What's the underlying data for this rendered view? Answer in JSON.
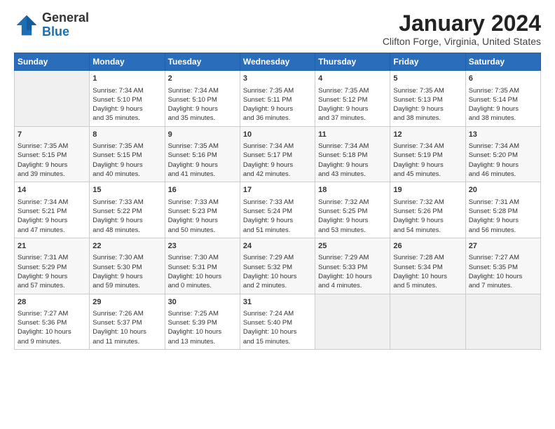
{
  "header": {
    "logo_general": "General",
    "logo_blue": "Blue",
    "main_title": "January 2024",
    "subtitle": "Clifton Forge, Virginia, United States"
  },
  "days_of_week": [
    "Sunday",
    "Monday",
    "Tuesday",
    "Wednesday",
    "Thursday",
    "Friday",
    "Saturday"
  ],
  "weeks": [
    [
      {
        "day": "",
        "content": ""
      },
      {
        "day": "1",
        "content": "Sunrise: 7:34 AM\nSunset: 5:10 PM\nDaylight: 9 hours\nand 35 minutes."
      },
      {
        "day": "2",
        "content": "Sunrise: 7:34 AM\nSunset: 5:10 PM\nDaylight: 9 hours\nand 35 minutes."
      },
      {
        "day": "3",
        "content": "Sunrise: 7:35 AM\nSunset: 5:11 PM\nDaylight: 9 hours\nand 36 minutes."
      },
      {
        "day": "4",
        "content": "Sunrise: 7:35 AM\nSunset: 5:12 PM\nDaylight: 9 hours\nand 37 minutes."
      },
      {
        "day": "5",
        "content": "Sunrise: 7:35 AM\nSunset: 5:13 PM\nDaylight: 9 hours\nand 38 minutes."
      },
      {
        "day": "6",
        "content": "Sunrise: 7:35 AM\nSunset: 5:14 PM\nDaylight: 9 hours\nand 38 minutes."
      }
    ],
    [
      {
        "day": "7",
        "content": "Sunrise: 7:35 AM\nSunset: 5:15 PM\nDaylight: 9 hours\nand 39 minutes."
      },
      {
        "day": "8",
        "content": "Sunrise: 7:35 AM\nSunset: 5:15 PM\nDaylight: 9 hours\nand 40 minutes."
      },
      {
        "day": "9",
        "content": "Sunrise: 7:35 AM\nSunset: 5:16 PM\nDaylight: 9 hours\nand 41 minutes."
      },
      {
        "day": "10",
        "content": "Sunrise: 7:34 AM\nSunset: 5:17 PM\nDaylight: 9 hours\nand 42 minutes."
      },
      {
        "day": "11",
        "content": "Sunrise: 7:34 AM\nSunset: 5:18 PM\nDaylight: 9 hours\nand 43 minutes."
      },
      {
        "day": "12",
        "content": "Sunrise: 7:34 AM\nSunset: 5:19 PM\nDaylight: 9 hours\nand 45 minutes."
      },
      {
        "day": "13",
        "content": "Sunrise: 7:34 AM\nSunset: 5:20 PM\nDaylight: 9 hours\nand 46 minutes."
      }
    ],
    [
      {
        "day": "14",
        "content": "Sunrise: 7:34 AM\nSunset: 5:21 PM\nDaylight: 9 hours\nand 47 minutes."
      },
      {
        "day": "15",
        "content": "Sunrise: 7:33 AM\nSunset: 5:22 PM\nDaylight: 9 hours\nand 48 minutes."
      },
      {
        "day": "16",
        "content": "Sunrise: 7:33 AM\nSunset: 5:23 PM\nDaylight: 9 hours\nand 50 minutes."
      },
      {
        "day": "17",
        "content": "Sunrise: 7:33 AM\nSunset: 5:24 PM\nDaylight: 9 hours\nand 51 minutes."
      },
      {
        "day": "18",
        "content": "Sunrise: 7:32 AM\nSunset: 5:25 PM\nDaylight: 9 hours\nand 53 minutes."
      },
      {
        "day": "19",
        "content": "Sunrise: 7:32 AM\nSunset: 5:26 PM\nDaylight: 9 hours\nand 54 minutes."
      },
      {
        "day": "20",
        "content": "Sunrise: 7:31 AM\nSunset: 5:28 PM\nDaylight: 9 hours\nand 56 minutes."
      }
    ],
    [
      {
        "day": "21",
        "content": "Sunrise: 7:31 AM\nSunset: 5:29 PM\nDaylight: 9 hours\nand 57 minutes."
      },
      {
        "day": "22",
        "content": "Sunrise: 7:30 AM\nSunset: 5:30 PM\nDaylight: 9 hours\nand 59 minutes."
      },
      {
        "day": "23",
        "content": "Sunrise: 7:30 AM\nSunset: 5:31 PM\nDaylight: 10 hours\nand 0 minutes."
      },
      {
        "day": "24",
        "content": "Sunrise: 7:29 AM\nSunset: 5:32 PM\nDaylight: 10 hours\nand 2 minutes."
      },
      {
        "day": "25",
        "content": "Sunrise: 7:29 AM\nSunset: 5:33 PM\nDaylight: 10 hours\nand 4 minutes."
      },
      {
        "day": "26",
        "content": "Sunrise: 7:28 AM\nSunset: 5:34 PM\nDaylight: 10 hours\nand 5 minutes."
      },
      {
        "day": "27",
        "content": "Sunrise: 7:27 AM\nSunset: 5:35 PM\nDaylight: 10 hours\nand 7 minutes."
      }
    ],
    [
      {
        "day": "28",
        "content": "Sunrise: 7:27 AM\nSunset: 5:36 PM\nDaylight: 10 hours\nand 9 minutes."
      },
      {
        "day": "29",
        "content": "Sunrise: 7:26 AM\nSunset: 5:37 PM\nDaylight: 10 hours\nand 11 minutes."
      },
      {
        "day": "30",
        "content": "Sunrise: 7:25 AM\nSunset: 5:39 PM\nDaylight: 10 hours\nand 13 minutes."
      },
      {
        "day": "31",
        "content": "Sunrise: 7:24 AM\nSunset: 5:40 PM\nDaylight: 10 hours\nand 15 minutes."
      },
      {
        "day": "",
        "content": ""
      },
      {
        "day": "",
        "content": ""
      },
      {
        "day": "",
        "content": ""
      }
    ]
  ]
}
